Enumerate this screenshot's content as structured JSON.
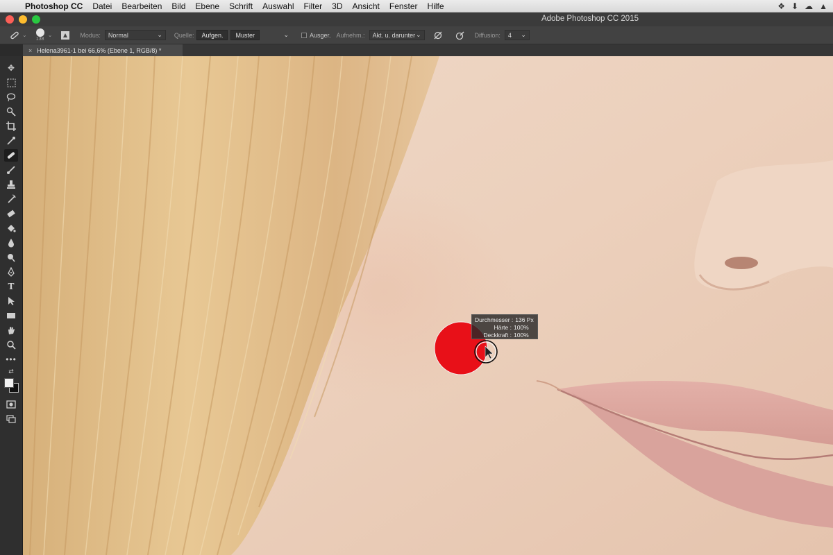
{
  "menubar": {
    "app": "Photoshop CC",
    "items": [
      "Datei",
      "Bearbeiten",
      "Bild",
      "Ebene",
      "Schrift",
      "Auswahl",
      "Filter",
      "3D",
      "Ansicht",
      "Fenster",
      "Hilfe"
    ]
  },
  "window": {
    "title": "Adobe Photoshop CC 2015"
  },
  "options": {
    "brush_size": "138",
    "modus_label": "Modus:",
    "modus_value": "Normal",
    "quelle_label": "Quelle:",
    "aufgen_label": "Aufgen.",
    "muster_label": "Muster",
    "ausger_label": "Ausger.",
    "aufnehm_label": "Aufnehm.:",
    "aufnehm_value": "Akt. u. darunter",
    "diffusion_label": "Diffusion:",
    "diffusion_value": "4"
  },
  "document": {
    "tab_title": "Helena3961-1 bei 66,6% (Ebene 1, RGB/8) *",
    "close_glyph": "×"
  },
  "tooltip": {
    "rows": [
      {
        "key": "Durchmesser :",
        "value": "136 Px"
      },
      {
        "key": "Härte :",
        "value": "100%"
      },
      {
        "key": "Deckkraft :",
        "value": "100%"
      }
    ]
  },
  "icons": {
    "apple": "",
    "options_tool": "healing-brush-icon",
    "pressure": "tablet-pressure-icon"
  },
  "colors": {
    "brush_overlay": "#e81018",
    "foreground": "#f2f2f2",
    "background": "#111111"
  }
}
